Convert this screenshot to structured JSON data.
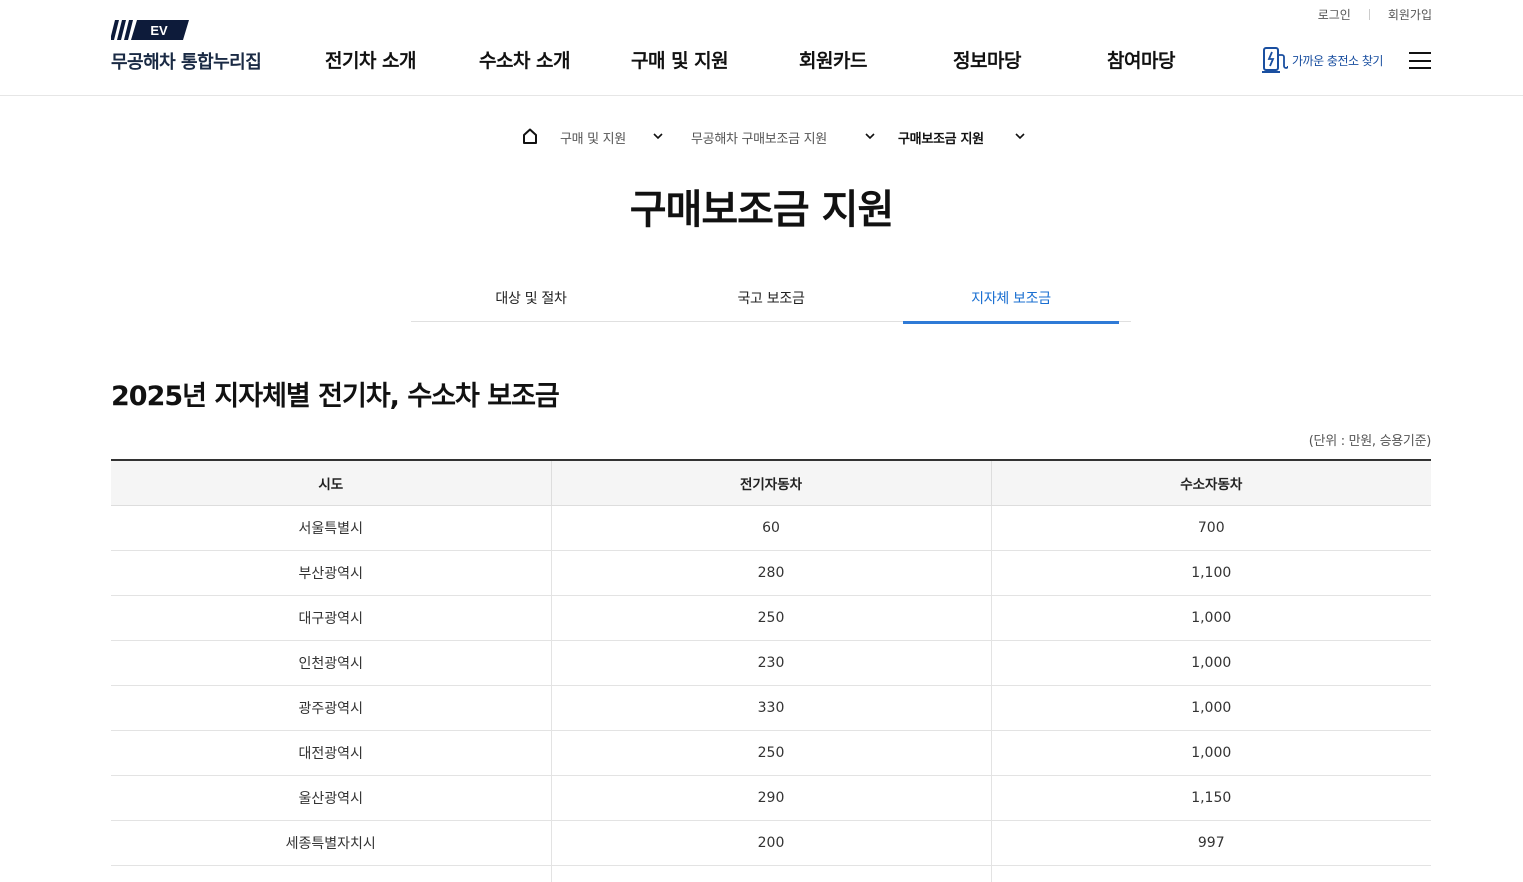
{
  "header": {
    "util": {
      "login": "로그인",
      "signup": "회원가입"
    },
    "logo": {
      "mark_text": "EV",
      "title": "무공해차 통합누리집"
    },
    "gnb": [
      "전기차 소개",
      "수소차 소개",
      "구매 및 지원",
      "회원카드",
      "정보마당",
      "참여마당"
    ],
    "charger_label": "가까운 충전소 찾기"
  },
  "breadcrumb": {
    "items": [
      "구매 및 지원",
      "무공해차 구매보조금 지원",
      "구매보조금 지원"
    ]
  },
  "page_title": "구매보조금 지원",
  "tabs": [
    "대상 및 절차",
    "국고 보조금",
    "지자체 보조금"
  ],
  "active_tab": 2,
  "section_title": "2025년 지자체별 전기차, 수소차 보조금",
  "unit_note": "(단위 : 만원, 승용기준)",
  "table": {
    "headers": [
      "시도",
      "전기자동차",
      "수소자동차"
    ],
    "rows": [
      [
        "서울특별시",
        "60",
        "700"
      ],
      [
        "부산광역시",
        "280",
        "1,100"
      ],
      [
        "대구광역시",
        "250",
        "1,000"
      ],
      [
        "인천광역시",
        "230",
        "1,000"
      ],
      [
        "광주광역시",
        "330",
        "1,000"
      ],
      [
        "대전광역시",
        "250",
        "1,000"
      ],
      [
        "울산광역시",
        "290",
        "1,150"
      ],
      [
        "세종특별자치시",
        "200",
        "997"
      ],
      [
        "",
        "",
        ""
      ]
    ]
  },
  "colors": {
    "accent": "#2f7ad6",
    "brand_navy": "#0d1b3a",
    "text": "#111111"
  }
}
